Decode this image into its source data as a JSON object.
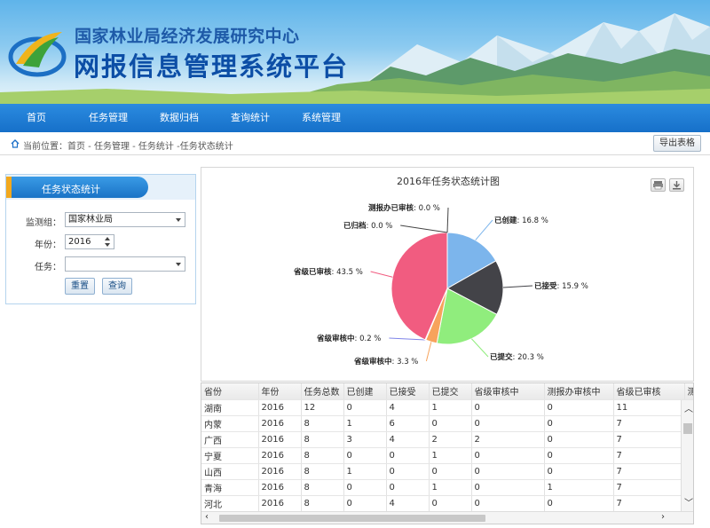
{
  "header": {
    "org_name": "国家林业局经济发展研究中心",
    "system_name": "网报信息管理系统平台"
  },
  "nav": [
    "首页",
    "任务管理",
    "数据归档",
    "查询统计",
    "系统管理"
  ],
  "breadcrumb": "当前位置：首页 - 任务管理 - 任务统计 -任务状态统计",
  "export_label": "导出表格",
  "panel": {
    "title": "任务状态统计",
    "group_label": "监测组：",
    "group_value": "国家林业局",
    "year_label": "年份：",
    "year_value": "2016",
    "task_label": "任务：",
    "task_value": "",
    "reset_label": "重置",
    "query_label": "查询"
  },
  "chart_data": {
    "type": "pie",
    "title": "2016年任务状态统计图",
    "slices": [
      {
        "label": "已创建",
        "value": 16.8,
        "display": "16.8 %",
        "color": "#7cb5ec"
      },
      {
        "label": "已接受",
        "value": 15.9,
        "display": "15.9 %",
        "color": "#434348"
      },
      {
        "label": "已提交",
        "value": 20.3,
        "display": "20.3 %",
        "color": "#90ed7d"
      },
      {
        "label": "省级审核中",
        "value": 3.3,
        "display": "3.3 %",
        "color": "#f7a35c"
      },
      {
        "label": "省级审核中",
        "value": 0.2,
        "display": "0.2 %",
        "color": "#8085e9"
      },
      {
        "label": "省级已审核",
        "value": 43.5,
        "display": "43.5 %",
        "color": "#f15c80"
      },
      {
        "label": "已归档",
        "value": 0.0,
        "display": "0.0 %",
        "color": "#e4d354"
      },
      {
        "label": "测报办已审核",
        "value": 0.0,
        "display": "0.0 %",
        "color": "#2b908f"
      }
    ]
  },
  "table": {
    "columns": [
      "省份",
      "年份",
      "任务总数",
      "已创建",
      "已接受",
      "已提交",
      "省级审核中",
      "测报办审核中",
      "省级已审核",
      "测"
    ],
    "rows": [
      [
        "湖南",
        "2016",
        "12",
        "0",
        "4",
        "1",
        "0",
        "0",
        "11"
      ],
      [
        "内蒙",
        "2016",
        "8",
        "1",
        "6",
        "0",
        "0",
        "0",
        "7"
      ],
      [
        "广西",
        "2016",
        "8",
        "3",
        "4",
        "2",
        "2",
        "0",
        "7"
      ],
      [
        "宁夏",
        "2016",
        "8",
        "0",
        "0",
        "1",
        "0",
        "0",
        "7"
      ],
      [
        "山西",
        "2016",
        "8",
        "1",
        "0",
        "0",
        "0",
        "0",
        "7"
      ],
      [
        "青海",
        "2016",
        "8",
        "0",
        "0",
        "1",
        "0",
        "1",
        "7"
      ],
      [
        "河北",
        "2016",
        "8",
        "0",
        "4",
        "0",
        "0",
        "0",
        "7"
      ]
    ]
  }
}
